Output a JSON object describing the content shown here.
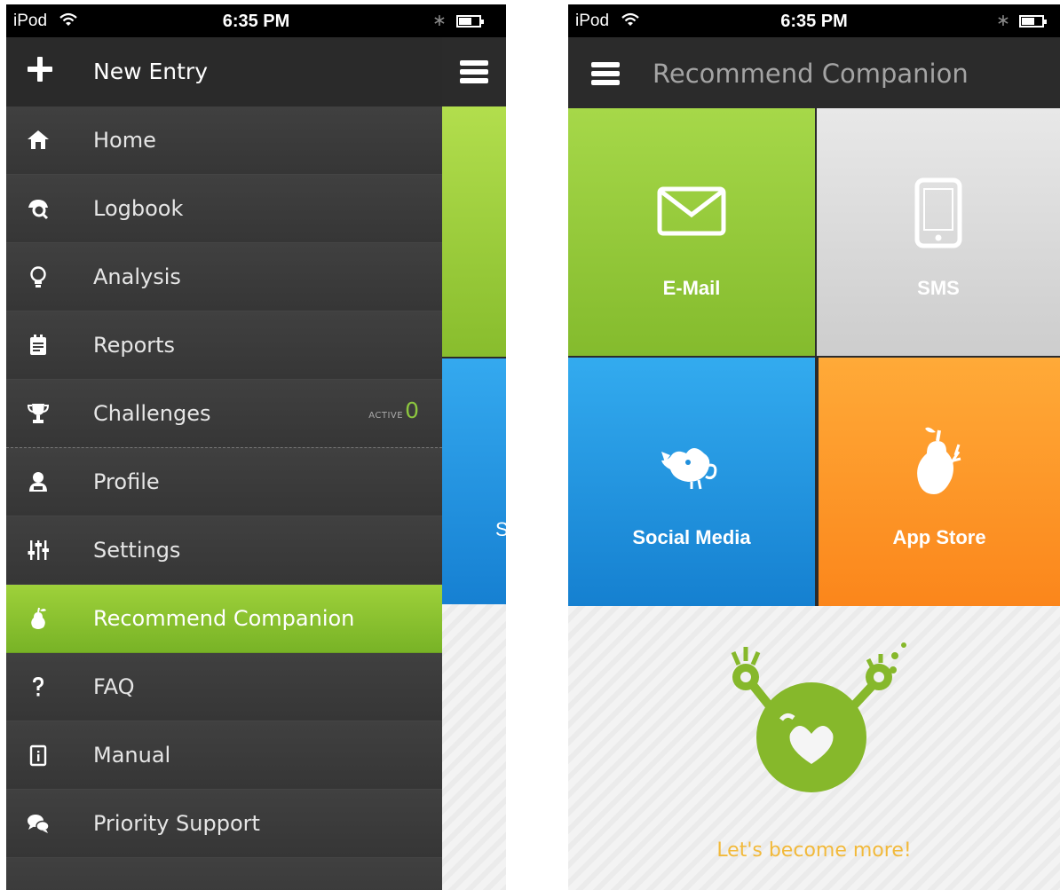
{
  "status_bar": {
    "carrier": "iPod",
    "time": "6:35 PM"
  },
  "left_screen": {
    "header": {
      "new_entry_label": "New Entry"
    },
    "menu": [
      {
        "label": "Home",
        "icon": "home-icon"
      },
      {
        "label": "Logbook",
        "icon": "logbook-icon"
      },
      {
        "label": "Analysis",
        "icon": "lightbulb-icon"
      },
      {
        "label": "Reports",
        "icon": "reports-icon"
      },
      {
        "label": "Challenges",
        "icon": "trophy-icon",
        "badge_label": "ACTIVE",
        "badge_count": "0"
      },
      {
        "label": "Profile",
        "icon": "profile-icon"
      },
      {
        "label": "Settings",
        "icon": "sliders-icon"
      },
      {
        "label": "Recommend Companion",
        "icon": "pear-icon",
        "active": true
      },
      {
        "label": "FAQ",
        "icon": "question-icon"
      },
      {
        "label": "Manual",
        "icon": "manual-icon"
      },
      {
        "label": "Priority Support",
        "icon": "chat-icon"
      }
    ],
    "behind_partial_text": "S"
  },
  "right_screen": {
    "title": "Recommend Companion",
    "tiles": [
      {
        "label": "E-Mail",
        "icon": "envelope-icon",
        "color": "#97cb3b"
      },
      {
        "label": "SMS",
        "icon": "phone-icon",
        "color": "#d9d9d9"
      },
      {
        "label": "Social Media",
        "icon": "bird-icon",
        "color": "#249ae4"
      },
      {
        "label": "App Store",
        "icon": "pear-icon",
        "color": "#fd9a2a"
      }
    ],
    "tagline": "Let's become more!"
  },
  "colors": {
    "accent_green": "#8cc63f",
    "drawer_bg": "#3a3a3a",
    "tagline": "#f2b93a"
  }
}
